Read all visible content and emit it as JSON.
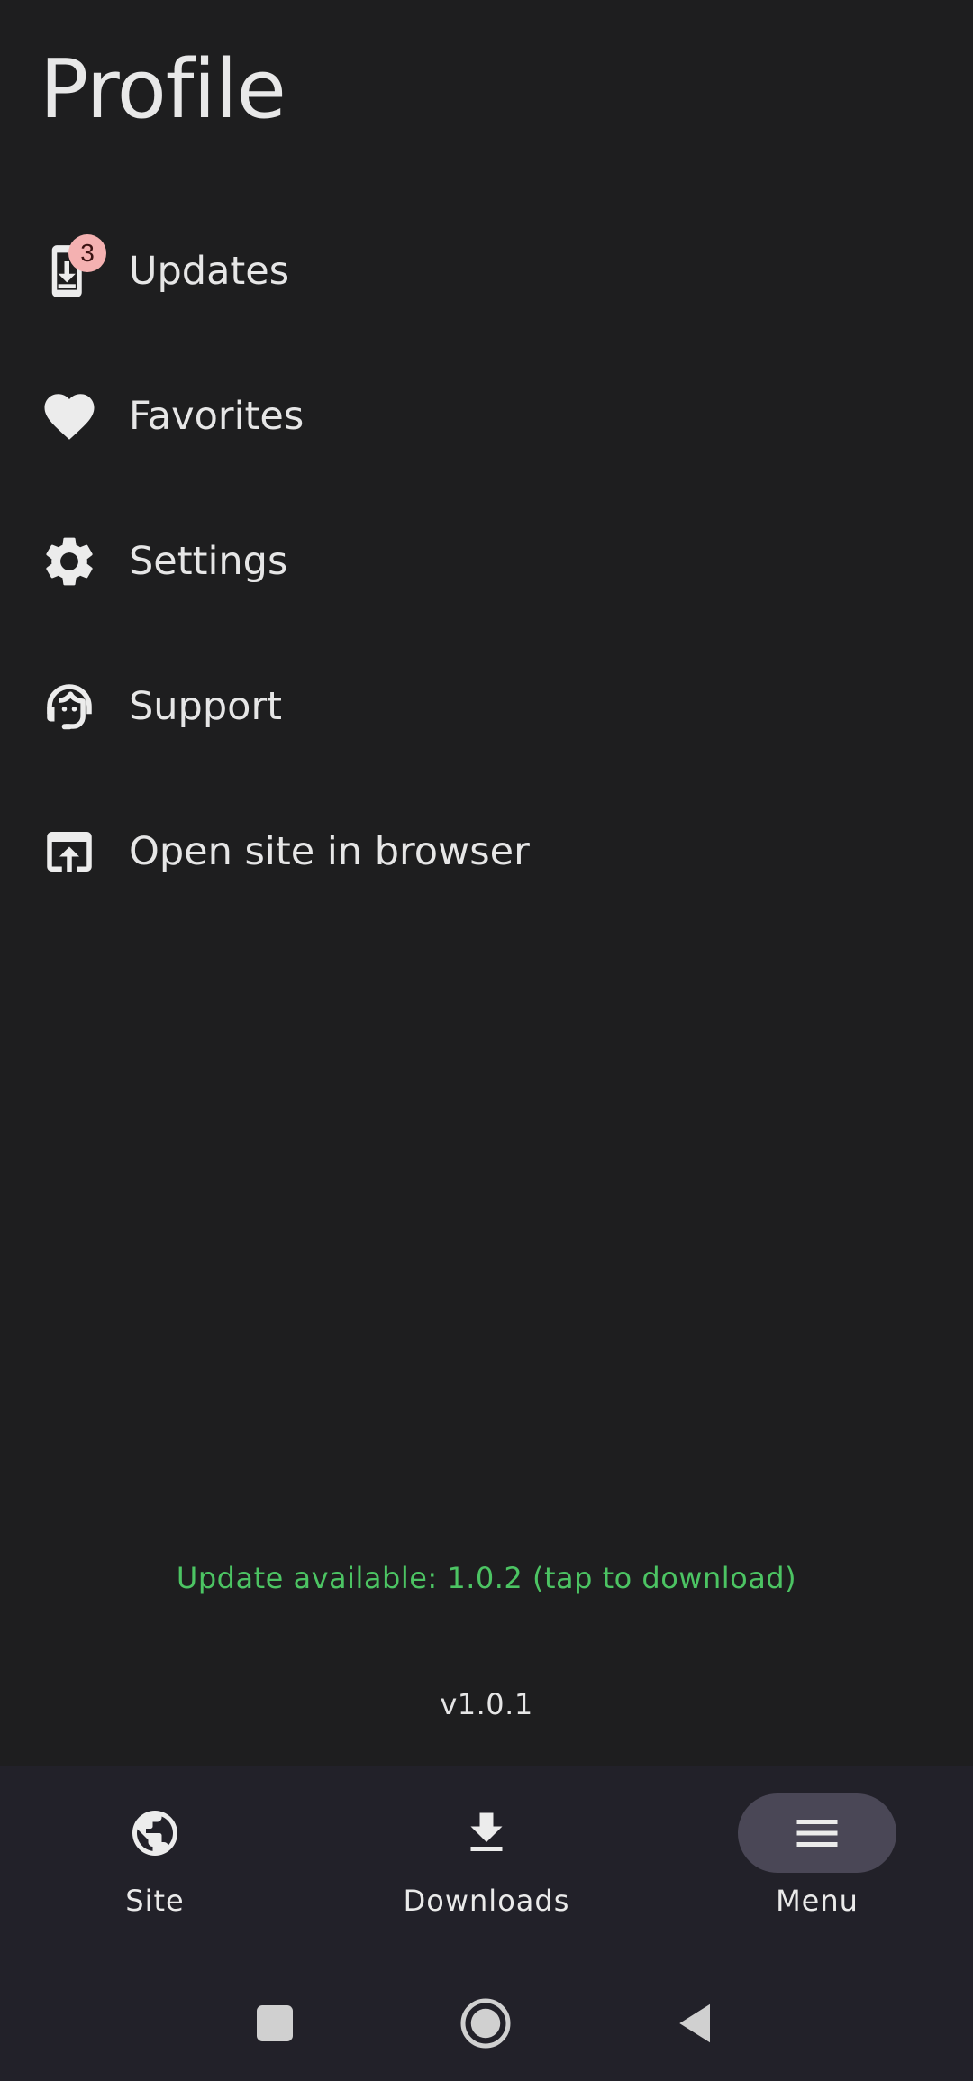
{
  "header": {
    "title": "Profile"
  },
  "menu": {
    "items": [
      {
        "label": "Updates",
        "icon": "phone-update-icon",
        "badge": "3"
      },
      {
        "label": "Favorites",
        "icon": "heart-icon"
      },
      {
        "label": "Settings",
        "icon": "gear-icon"
      },
      {
        "label": "Support",
        "icon": "support-agent-icon"
      },
      {
        "label": "Open site in browser",
        "icon": "open-in-browser-icon"
      }
    ]
  },
  "footer": {
    "update_message": "Update available: 1.0.2 (tap to download)",
    "version": "v1.0.1"
  },
  "bottom_nav": {
    "items": [
      {
        "label": "Site",
        "icon": "globe-icon",
        "active": false
      },
      {
        "label": "Downloads",
        "icon": "download-icon",
        "active": false
      },
      {
        "label": "Menu",
        "icon": "menu-icon",
        "active": true
      }
    ]
  },
  "system_nav": {
    "icons": [
      "recents-square-icon",
      "home-circle-icon",
      "back-triangle-icon"
    ]
  },
  "colors": {
    "background": "#1e1e1f",
    "update_text": "#4cc463",
    "badge": "#f4b1b1",
    "nav_background": "#222129",
    "active_pill": "#4a4756"
  }
}
